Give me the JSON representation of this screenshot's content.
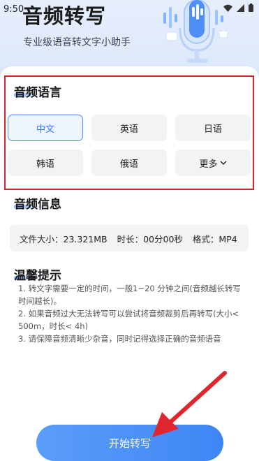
{
  "status_bar": {
    "time": "9:50",
    "icons": [
      "wifi-icon",
      "signal-icon",
      "battery-icon"
    ]
  },
  "header": {
    "title": "音频转写",
    "subtitle": "专业级语音转文字小助手"
  },
  "language_section": {
    "title": "音频语言",
    "options": [
      {
        "label": "中文",
        "selected": true
      },
      {
        "label": "英语",
        "selected": false
      },
      {
        "label": "日语",
        "selected": false
      },
      {
        "label": "韩语",
        "selected": false
      },
      {
        "label": "俄语",
        "selected": false
      },
      {
        "label": "更多",
        "selected": false,
        "icon": "chevron-down-icon"
      }
    ]
  },
  "info_section": {
    "title": "音频信息",
    "file_size": "文件大小：23.321MB",
    "duration": "时长：00分00秒",
    "format": "格式：MP4"
  },
  "tips_section": {
    "title": "温馨提示",
    "lines": [
      "1. 转文字需要一定的时间，一般1~20 分钟之间(音频越长转写时间越长)。",
      "2. 如果音频过大无法转写可以尝试将音频裁剪后再转写(大小< 500m，时长< 4h)",
      "3. 请保障音频清晰少杂音，同时记得选择正确的音频语音"
    ]
  },
  "start_button": {
    "label": "开始转写"
  },
  "colors": {
    "accent": "#3e86f5",
    "annotation_red": "#d8232a",
    "header_bg": "#e6eefc"
  }
}
